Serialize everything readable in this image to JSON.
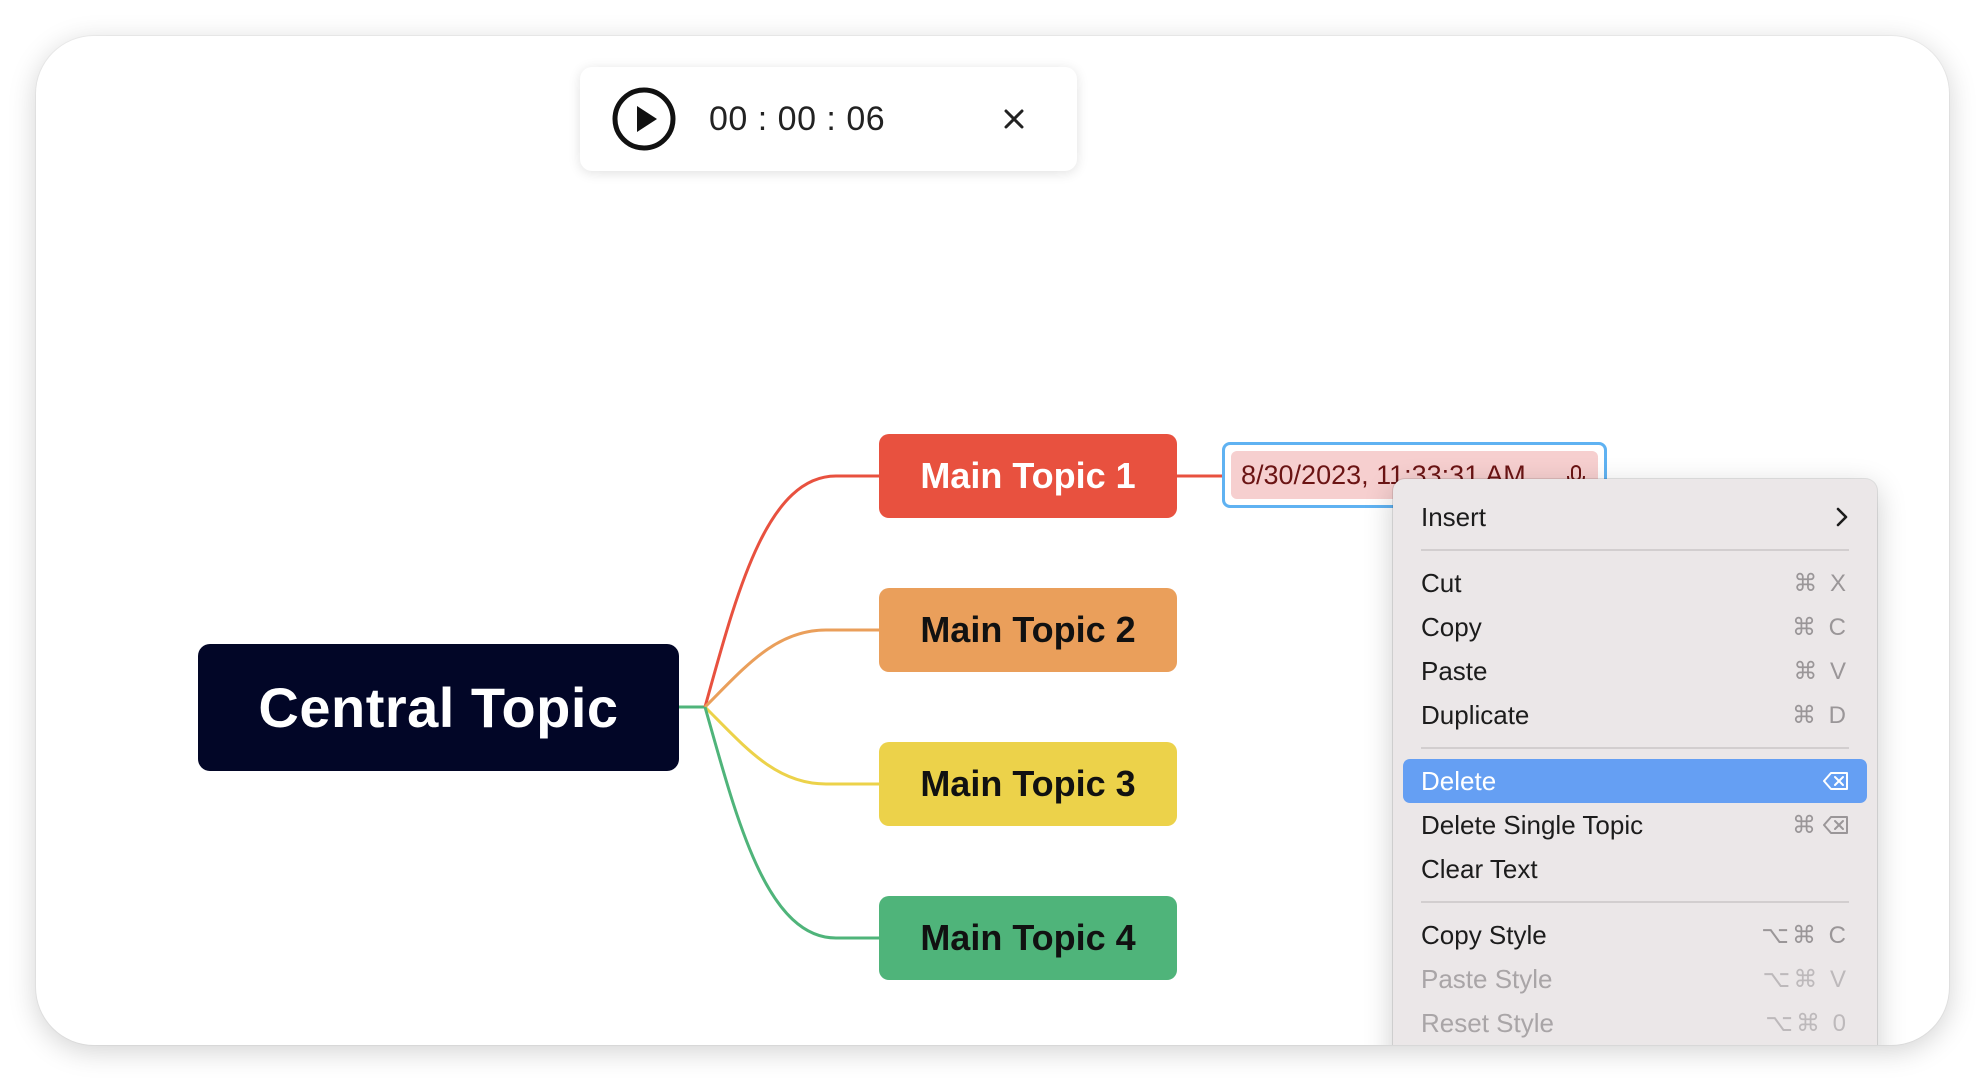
{
  "player": {
    "play_icon": "play-circle-icon",
    "time": "00 : 00 : 06",
    "close_icon": "close-icon"
  },
  "mindmap": {
    "central": "Central Topic",
    "topics": [
      {
        "label": "Main Topic 1",
        "color": "#e8513f"
      },
      {
        "label": "Main Topic 2",
        "color": "#ea9f5b"
      },
      {
        "label": "Main Topic 3",
        "color": "#ecd24a"
      },
      {
        "label": "Main Topic 4",
        "color": "#4fb47a"
      }
    ],
    "audio_note": {
      "text": "8/30/2023, 11:33:31 AM",
      "icon": "microphone-icon"
    }
  },
  "context_menu": {
    "insert": {
      "label": "Insert",
      "icon": "chevron-right-icon"
    },
    "cut": {
      "label": "Cut",
      "shortcut": "⌘ X"
    },
    "copy": {
      "label": "Copy",
      "shortcut": "⌘ C"
    },
    "paste": {
      "label": "Paste",
      "shortcut": "⌘ V"
    },
    "duplicate": {
      "label": "Duplicate",
      "shortcut": "⌘ D"
    },
    "delete": {
      "label": "Delete",
      "icon": "delete-key-icon"
    },
    "delete_single": {
      "label": "Delete Single Topic",
      "shortcut": "⌘",
      "icon": "delete-key-icon"
    },
    "clear_text": {
      "label": "Clear Text"
    },
    "copy_style": {
      "label": "Copy Style",
      "shortcut": "⌥⌘ C"
    },
    "paste_style": {
      "label": "Paste Style",
      "shortcut": "⌥⌘ V"
    },
    "reset_style": {
      "label": "Reset Style",
      "shortcut": "⌥⌘ 0"
    }
  },
  "colors": {
    "central_bg": "#020627",
    "selection_border": "#5fb2f2",
    "menu_highlight": "#659ff3"
  }
}
